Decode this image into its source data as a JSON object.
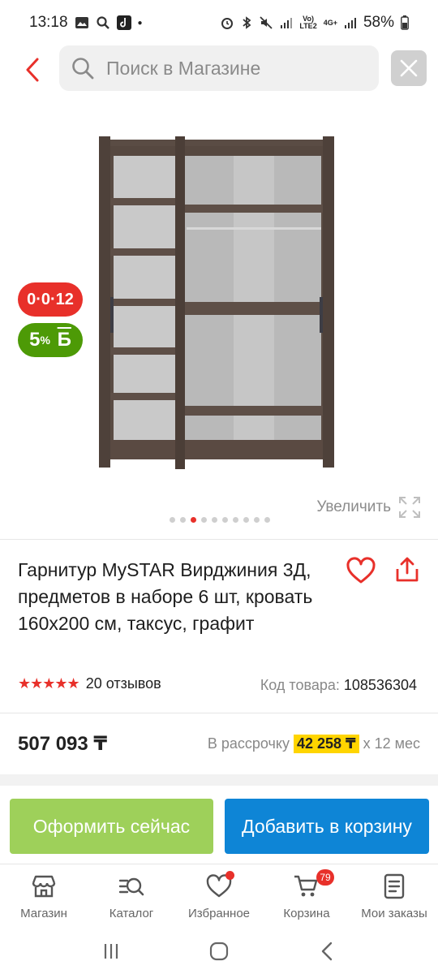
{
  "status_bar": {
    "time": "13:18",
    "battery": "58%",
    "net_label_top": "Vo)",
    "net_label_bottom": "LTE2",
    "net_4g": "4G+"
  },
  "search": {
    "placeholder": "Поиск в Магазине"
  },
  "gallery": {
    "installment_badge": "0·0·12",
    "bonus_badge_value": "5",
    "bonus_badge_unit": "%",
    "bonus_badge_letter": "Б",
    "zoom_label": "Увеличить",
    "dots_total": 10,
    "dots_active": 2
  },
  "product": {
    "title": "Гарнитур MySTAR Вирджиния 3Д, предметов в наборе 6 шт, кровать 160х200 см, таксус, графит",
    "rating": 5,
    "reviews": "20 отзывов",
    "sku_label": "Код товара:",
    "sku_value": "108536304",
    "price": "507 093 ₸",
    "installment_prefix": "В рассрочку",
    "installment_amount": "42 258 ₸",
    "installment_suffix": "х 12 мес"
  },
  "actions": {
    "buy_now": "Оформить сейчас",
    "add_to_cart": "Добавить в корзину"
  },
  "bottom_nav": {
    "items": [
      {
        "label": "Магазин",
        "icon": "store-icon"
      },
      {
        "label": "Каталог",
        "icon": "catalog-search-icon"
      },
      {
        "label": "Избранное",
        "icon": "heart-icon"
      },
      {
        "label": "Корзина",
        "icon": "cart-icon"
      },
      {
        "label": "Мои заказы",
        "icon": "orders-icon"
      }
    ],
    "cart_count": "79"
  },
  "colors": {
    "accent_red": "#e8302a",
    "buy_green": "#9ed05a",
    "cart_blue": "#0e85d6",
    "bonus_green": "#4d9a06",
    "installment_yellow": "#ffd500"
  }
}
